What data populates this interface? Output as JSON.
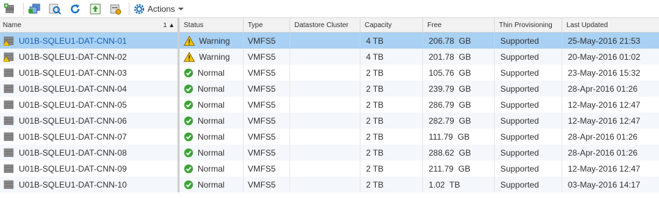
{
  "toolbar": {
    "buttons": [
      "new-datastore-icon",
      "register-vm-icon",
      "browse-files-icon",
      "refresh-icon",
      "increase-capacity-icon",
      "datastore-settings-icon"
    ],
    "actions_label": "Actions"
  },
  "columns": {
    "name": "Name",
    "sort_order": "1 ▲",
    "status": "Status",
    "type": "Type",
    "cluster": "Datastore Cluster",
    "capacity": "Capacity",
    "free": "Free",
    "thin": "Thin Provisioning",
    "updated": "Last Updated"
  },
  "rows": [
    {
      "name": "U01B-SQLEU1-DAT-CNN-01",
      "status": "Warning",
      "type": "VMFS5",
      "cluster": "",
      "capacity": "4 TB",
      "free": "206.78  GB",
      "thin": "Supported",
      "updated": "25-May-2016 21:53"
    },
    {
      "name": "U01B-SQLEU1-DAT-CNN-02",
      "status": "Warning",
      "type": "VMFS5",
      "cluster": "",
      "capacity": "4 TB",
      "free": "201.78  GB",
      "thin": "Supported",
      "updated": "20-May-2016 01:02"
    },
    {
      "name": "U01B-SQLEU1-DAT-CNN-03",
      "status": "Normal",
      "type": "VMFS5",
      "cluster": "",
      "capacity": "2 TB",
      "free": "105.76  GB",
      "thin": "Supported",
      "updated": "23-May-2016 15:32"
    },
    {
      "name": "U01B-SQLEU1-DAT-CNN-04",
      "status": "Normal",
      "type": "VMFS5",
      "cluster": "",
      "capacity": "2 TB",
      "free": "239.79  GB",
      "thin": "Supported",
      "updated": "28-Apr-2016 01:26"
    },
    {
      "name": "U01B-SQLEU1-DAT-CNN-05",
      "status": "Normal",
      "type": "VMFS5",
      "cluster": "",
      "capacity": "2 TB",
      "free": "286.79  GB",
      "thin": "Supported",
      "updated": "12-May-2016 12:47"
    },
    {
      "name": "U01B-SQLEU1-DAT-CNN-06",
      "status": "Normal",
      "type": "VMFS5",
      "cluster": "",
      "capacity": "2 TB",
      "free": "282.79  GB",
      "thin": "Supported",
      "updated": "12-May-2016 12:47"
    },
    {
      "name": "U01B-SQLEU1-DAT-CNN-07",
      "status": "Normal",
      "type": "VMFS5",
      "cluster": "",
      "capacity": "2 TB",
      "free": "111.79  GB",
      "thin": "Supported",
      "updated": "28-Apr-2016 01:26"
    },
    {
      "name": "U01B-SQLEU1-DAT-CNN-08",
      "status": "Normal",
      "type": "VMFS5",
      "cluster": "",
      "capacity": "2 TB",
      "free": "288.62  GB",
      "thin": "Supported",
      "updated": "28-Apr-2016 01:26"
    },
    {
      "name": "U01B-SQLEU1-DAT-CNN-09",
      "status": "Normal",
      "type": "VMFS5",
      "cluster": "",
      "capacity": "2 TB",
      "free": "211.79  GB",
      "thin": "Supported",
      "updated": "12-May-2016 12:47"
    },
    {
      "name": "U01B-SQLEU1-DAT-CNN-10",
      "status": "Normal",
      "type": "VMFS5",
      "cluster": "",
      "capacity": "2 TB",
      "free": "1.02  TB",
      "thin": "Supported",
      "updated": "03-May-2016 14:17"
    }
  ],
  "selected_row": 0,
  "colors": {
    "selected": "#a8d1f4",
    "normal_status": "#3aa335",
    "warning_status": "#f2c200",
    "link": "#1a5fb4"
  }
}
